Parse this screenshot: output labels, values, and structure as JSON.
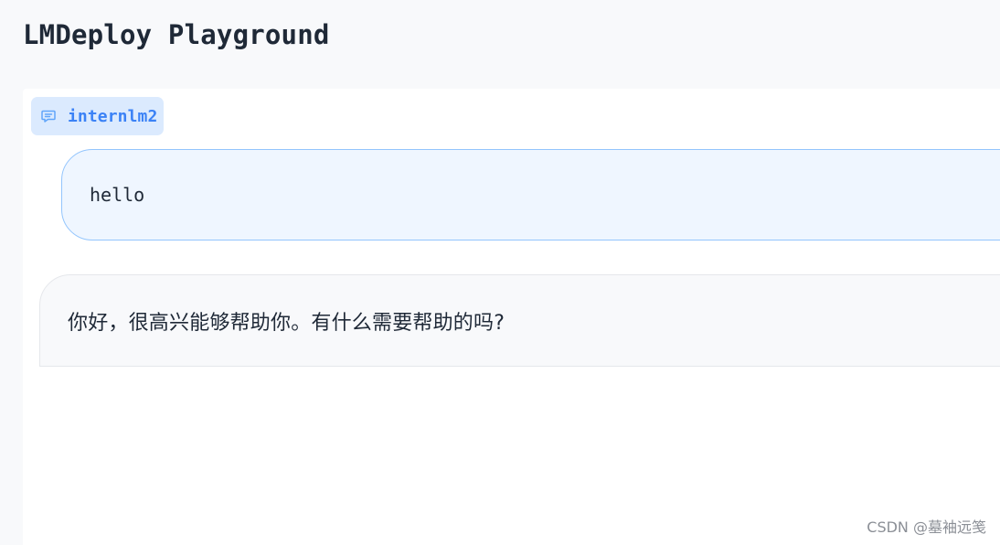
{
  "app": {
    "title": "LMDeploy Playground"
  },
  "chat": {
    "model_label": "internlm2",
    "model_icon": "chat-bubble-icon",
    "messages": [
      {
        "role": "user",
        "text": "hello"
      },
      {
        "role": "assistant",
        "text": "你好，很高兴能够帮助你。有什么需要帮助的吗?"
      }
    ]
  },
  "watermark": {
    "text": "CSDN @墓袖远笺"
  },
  "colors": {
    "page_background": "#f8f9fb",
    "panel_background": "#ffffff",
    "chip_background": "#dbeafe",
    "chip_text": "#3b82f6",
    "user_bubble_background": "#eff6ff",
    "user_bubble_border": "#93c5fd",
    "assistant_bubble_background": "#f8f9fb",
    "assistant_bubble_border": "#e5e7eb"
  }
}
